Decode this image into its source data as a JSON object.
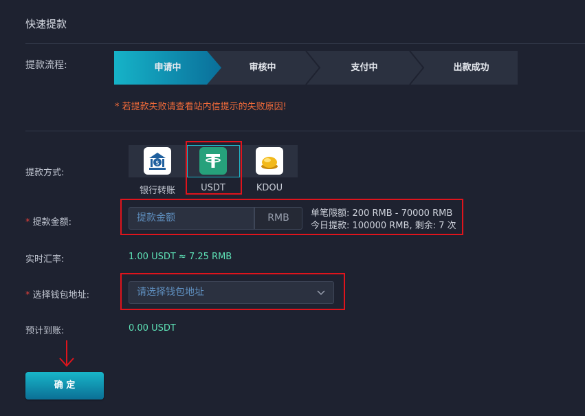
{
  "page": {
    "title": "快速提款"
  },
  "process": {
    "label": "提款流程:",
    "steps": [
      "申请中",
      "审核中",
      "支付中",
      "出款成功"
    ],
    "active_index": 0
  },
  "warning": "* 若提款失败请查看站内信提示的失败原因!",
  "method": {
    "label": "提款方式:",
    "options": [
      {
        "label": "银行转账",
        "icon": "bank-icon"
      },
      {
        "label": "USDT",
        "icon": "tether-icon",
        "selected": true
      },
      {
        "label": "KDOU",
        "icon": "gold-coin-icon"
      }
    ]
  },
  "amount": {
    "required_mark": "*",
    "label": "提款金额:",
    "placeholder": "提款金额",
    "unit": "RMB",
    "limit_line1": "单笔限额: 200 RMB - 70000 RMB",
    "limit_line2": "今日提款: 100000 RMB, 剩余: 7 次"
  },
  "rate": {
    "label": "实时汇率:",
    "value": "1.00 USDT ≈ 7.25 RMB"
  },
  "wallet": {
    "required_mark": "*",
    "label": "选择钱包地址:",
    "placeholder": "请选择钱包地址"
  },
  "arrival": {
    "label": "预计到账:",
    "value": "0.00 USDT"
  },
  "confirm": {
    "label": "确 定"
  },
  "colors": {
    "background": "#1e2230",
    "accent": "#16b3c8",
    "warning": "#f26b3a",
    "value_green": "#5ee3b7",
    "highlight_red": "#e0141c"
  }
}
